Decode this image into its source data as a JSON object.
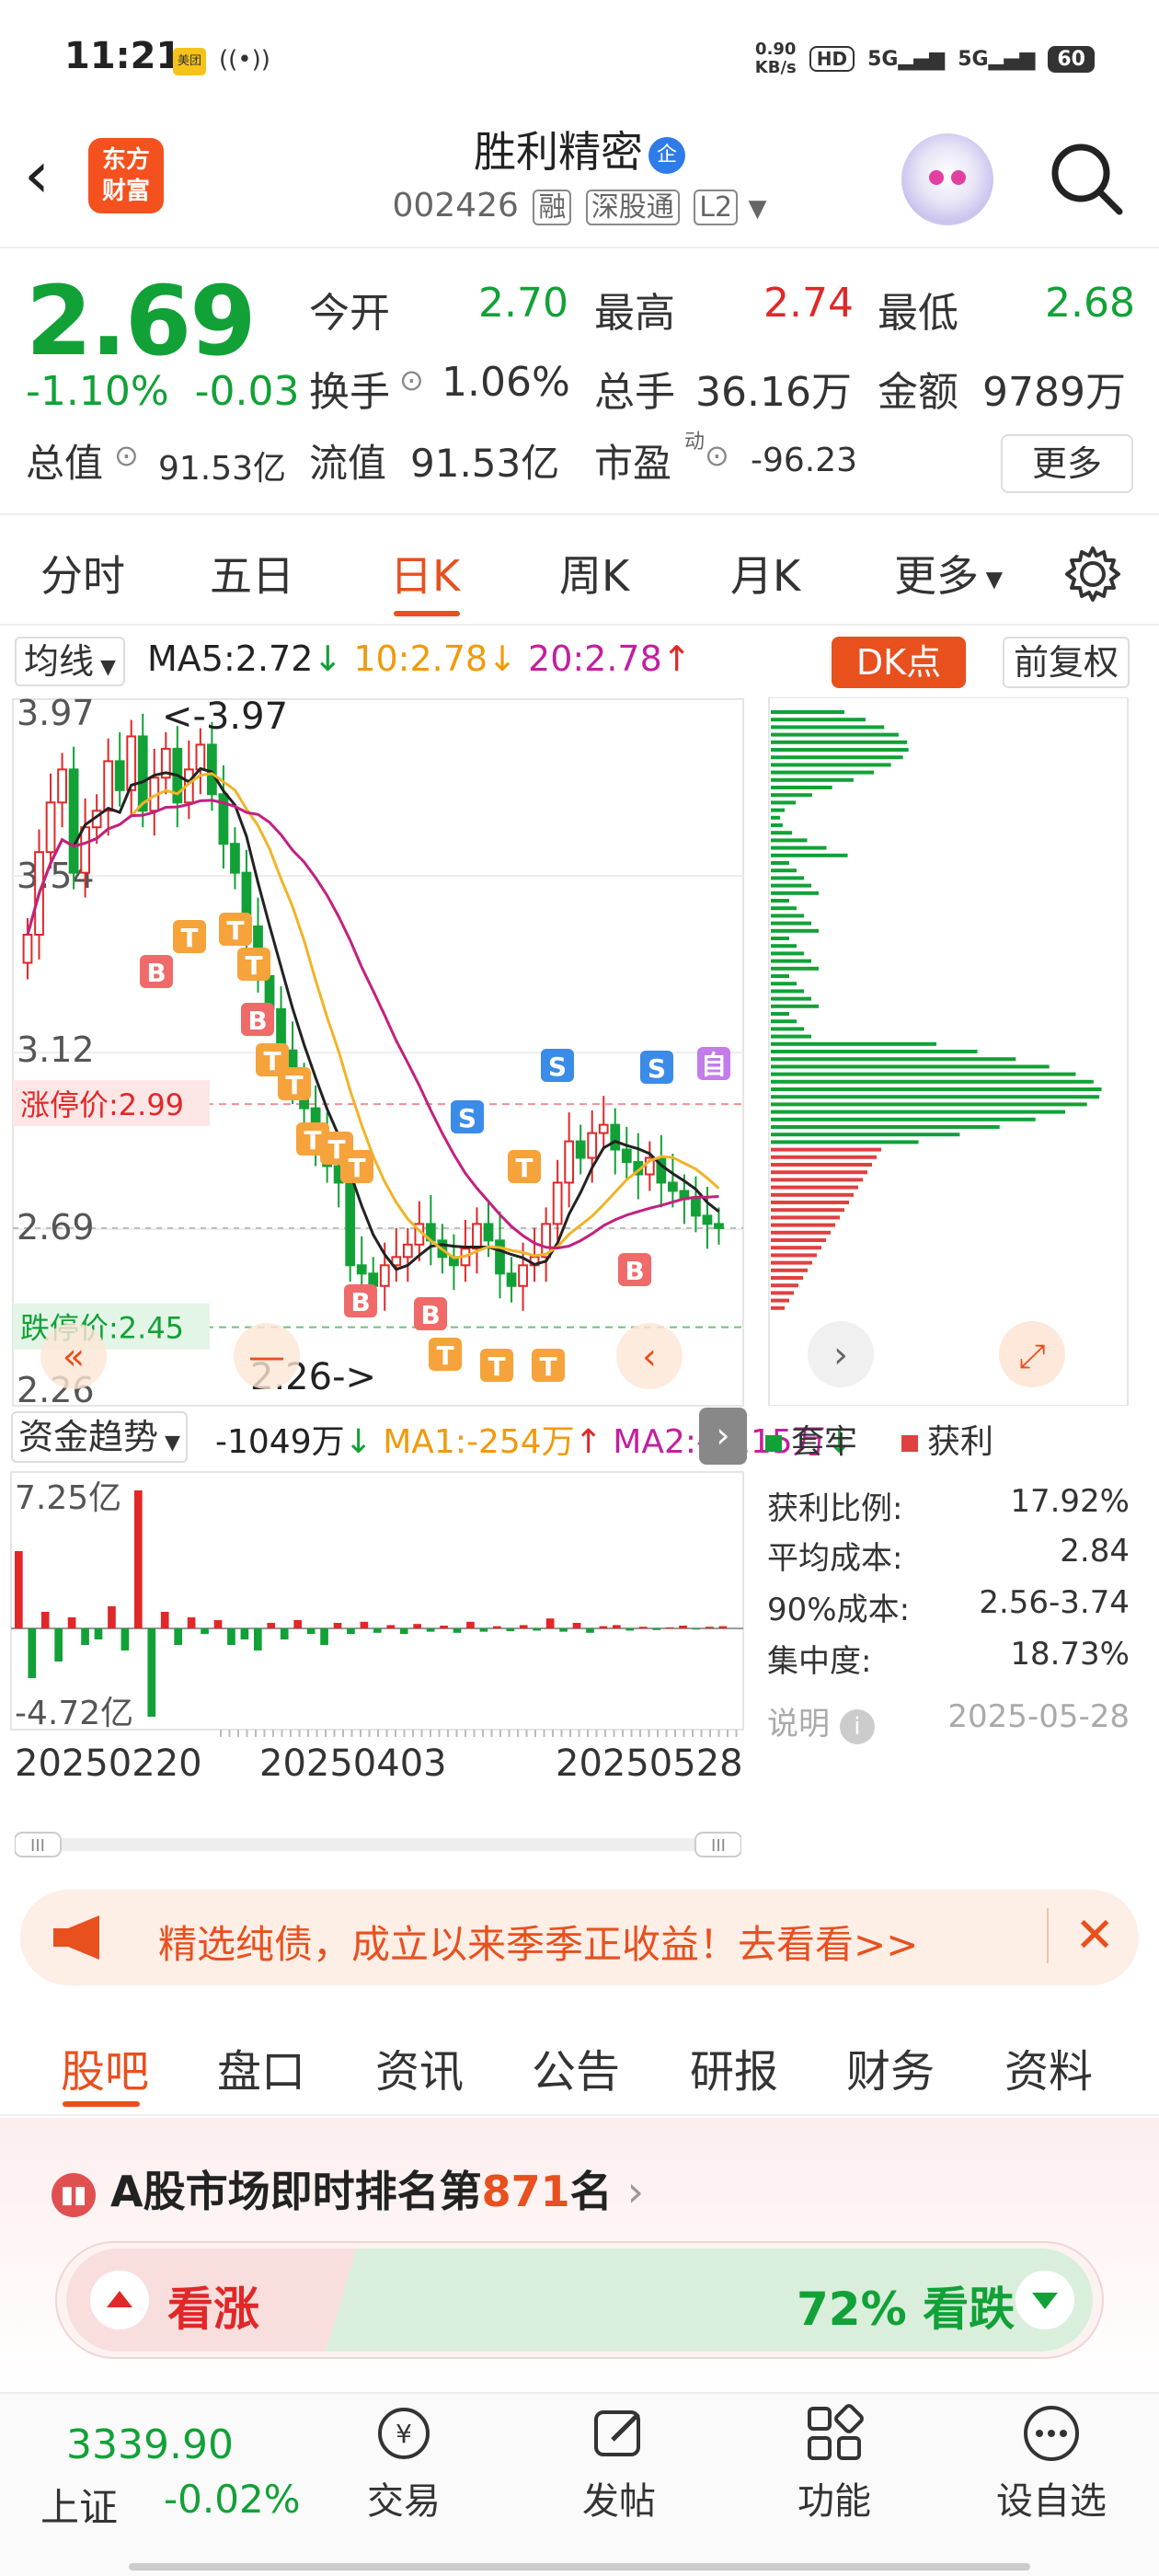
{
  "status_bar": {
    "time": "11:21",
    "app_badge": "美团",
    "net_speed_top": "0.90",
    "net_speed_unit": "KB/s",
    "hd": "HD",
    "net1": "5G",
    "net2": "5G",
    "battery": "60"
  },
  "header": {
    "logo_line1": "东方",
    "logo_line2": "财富",
    "stock_name": "胜利精密",
    "badge": "企",
    "code": "002426",
    "tags": [
      "融",
      "深股通",
      "L2"
    ]
  },
  "quote": {
    "price": "2.69",
    "change_pct": "-1.10%",
    "change_abs": "-0.03",
    "open_label": "今开",
    "open": "2.70",
    "high_label": "最高",
    "high": "2.74",
    "low_label": "最低",
    "low": "2.68",
    "turnover_label": "换手",
    "turnover": "1.06%",
    "volume_label": "总手",
    "volume": "36.16万",
    "amount_label": "金额",
    "amount": "9789万",
    "mktcap_label": "总值",
    "mktcap": "91.53亿",
    "float_label": "流值",
    "float_cap": "91.53亿",
    "pe_label": "市盈",
    "pe_sup": "动",
    "pe": "-96.23",
    "more": "更多"
  },
  "period_tabs": {
    "items": [
      "分时",
      "五日",
      "日K",
      "周K",
      "月K",
      "更多"
    ],
    "active": "日K"
  },
  "ma_row": {
    "selector": "均线",
    "ma5": "MA5:2.72",
    "ma10": "10:2.78",
    "ma20": "20:2.78",
    "dk": "DK点",
    "fuquan": "前复权"
  },
  "kline": {
    "y_ticks": [
      "3.97",
      "3.54",
      "3.12",
      "2.69",
      "2.26"
    ],
    "high_note": "<-3.97",
    "low_note": "2.26->",
    "limit_up": "涨停价:2.99",
    "limit_down": "跌停价:2.45",
    "markers": [
      "B",
      "T",
      "S",
      "自"
    ],
    "colors": {
      "up": "#e02828",
      "down": "#12a137",
      "ma5": "#222222",
      "ma10": "#f0b429",
      "ma20": "#c3207f"
    }
  },
  "fund": {
    "selector": "资金趋势",
    "value": "-1049万",
    "ma1": "MA1:-254万",
    "ma2": "MA2:-1115万",
    "y_top": "7.25亿",
    "y_bottom": "-4.72亿"
  },
  "dates": [
    "20250220",
    "20250403",
    "20250528"
  ],
  "chip": {
    "legend_hold": "套牢",
    "legend_profit": "获利",
    "stats": [
      {
        "label": "获利比例:",
        "value": "17.92%"
      },
      {
        "label": "平均成本:",
        "value": "2.84"
      },
      {
        "label": "90%成本:",
        "value": "2.56-3.74"
      },
      {
        "label": "集中度:",
        "value": "18.73%"
      }
    ],
    "note": "说明",
    "date": "2025-05-28"
  },
  "banner": {
    "text": "精选纯债，成立以来季季正收益！去看看>>"
  },
  "bottom_tabs": {
    "items": [
      "股吧",
      "盘口",
      "资讯",
      "公告",
      "研报",
      "财务",
      "资料"
    ],
    "active": "股吧"
  },
  "rank": {
    "prefix": "A股市场即时排名第",
    "number": "871",
    "suffix": "名"
  },
  "vote": {
    "up": "看涨",
    "down": "72% 看跌"
  },
  "index": {
    "value": "3339.90",
    "name": "上证",
    "change": "-0.02%"
  },
  "nav": [
    "交易",
    "发帖",
    "功能",
    "设自选"
  ],
  "chart_data": {
    "type": "candlestick",
    "x_range": [
      "20250220",
      "20250528"
    ],
    "ylim": [
      2.26,
      3.97
    ],
    "y_ticks": [
      3.97,
      3.54,
      3.12,
      2.69,
      2.26
    ],
    "limit_up": 2.99,
    "limit_down": 2.45,
    "last_close": 2.69,
    "ma": {
      "MA5": 2.72,
      "MA10": 2.78,
      "MA20": 2.78
    },
    "closes": [
      3.4,
      3.6,
      3.72,
      3.8,
      3.55,
      3.66,
      3.7,
      3.82,
      3.75,
      3.88,
      3.7,
      3.78,
      3.85,
      3.72,
      3.8,
      3.86,
      3.74,
      3.62,
      3.55,
      3.42,
      3.3,
      3.22,
      3.12,
      3.05,
      2.98,
      2.9,
      2.84,
      2.8,
      2.6,
      2.58,
      2.55,
      2.6,
      2.62,
      2.65,
      2.7,
      2.66,
      2.62,
      2.6,
      2.64,
      2.7,
      2.66,
      2.58,
      2.55,
      2.6,
      2.62,
      2.7,
      2.8,
      2.9,
      2.86,
      2.92,
      2.94,
      2.88,
      2.85,
      2.82,
      2.86,
      2.8,
      2.78,
      2.76,
      2.72,
      2.7,
      2.69
    ]
  }
}
